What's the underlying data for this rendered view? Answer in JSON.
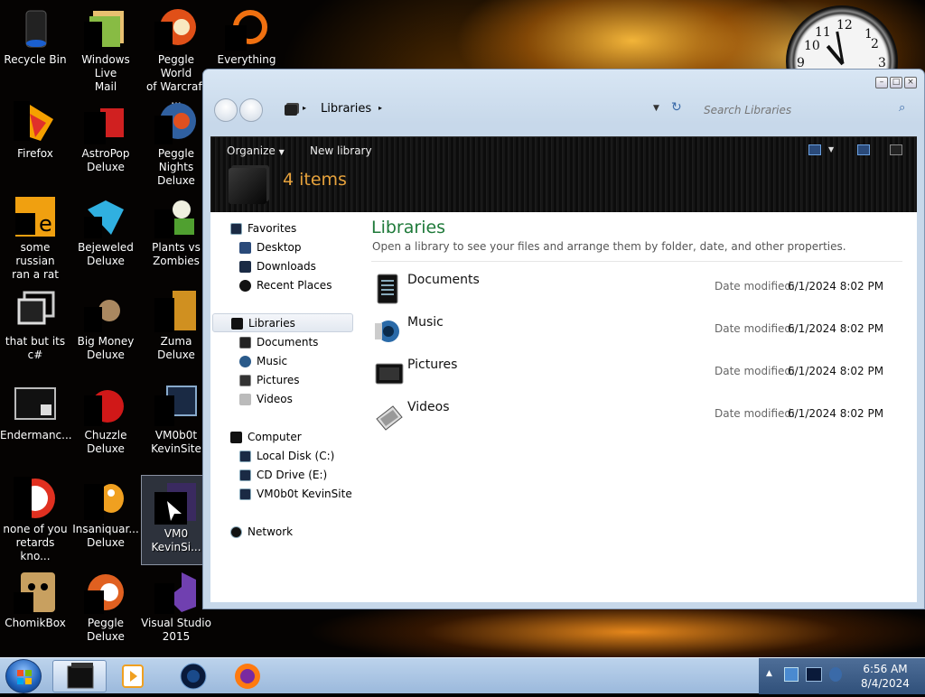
{
  "desktop": {
    "icons": [
      {
        "label": "Recycle Bin"
      },
      {
        "label": "Windows Live\nMail"
      },
      {
        "label": "Peggle World\nof Warcraft ..."
      },
      {
        "label": "Everything"
      },
      {
        "label": "Firefox"
      },
      {
        "label": "AstroPop\nDeluxe"
      },
      {
        "label": "Peggle Nights\nDeluxe"
      },
      {
        "label": "some russian\nran a rat"
      },
      {
        "label": "Bejeweled\nDeluxe"
      },
      {
        "label": "Plants vs\nZombies"
      },
      {
        "label": "that but its c#"
      },
      {
        "label": "Big Money\nDeluxe"
      },
      {
        "label": "Zuma Deluxe"
      },
      {
        "label": "Endermanc..."
      },
      {
        "label": "Chuzzle\nDeluxe"
      },
      {
        "label": "VM0b0t\nKevinSite"
      },
      {
        "label": "none of you\nretards kno..."
      },
      {
        "label": "Insaniquar...\nDeluxe"
      },
      {
        "label": "VM0\nKevinSi..."
      },
      {
        "label": "ChomikBox"
      },
      {
        "label": "Peggle Deluxe"
      },
      {
        "label": "Visual Studio\n2015"
      }
    ],
    "clock_numbers": [
      "12",
      "1",
      "2",
      "10",
      "11",
      "9",
      "3"
    ]
  },
  "window": {
    "breadcrumb": "Libraries",
    "search_placeholder": "Search Libraries",
    "toolbar": {
      "organize": "Organize",
      "new_library": "New library"
    },
    "item_count": "4 items",
    "nav": {
      "favorites": "Favorites",
      "desktop": "Desktop",
      "downloads": "Downloads",
      "recent": "Recent Places",
      "libraries": "Libraries",
      "documents": "Documents",
      "music": "Music",
      "pictures": "Pictures",
      "videos": "Videos",
      "computer": "Computer",
      "local_disk": "Local Disk (C:)",
      "cd_drive": "CD Drive (E:)",
      "vm_drive": "VM0b0t KevinSite",
      "network": "Network"
    },
    "main": {
      "title": "Libraries",
      "subtitle": "Open a library to see your files and arrange them by folder, date, and other properties.",
      "date_label": "Date modified:",
      "items": [
        {
          "name": "Documents",
          "date": "6/1/2024 8:02 PM"
        },
        {
          "name": "Music",
          "date": "6/1/2024 8:02 PM"
        },
        {
          "name": "Pictures",
          "date": "6/1/2024 8:02 PM"
        },
        {
          "name": "Videos",
          "date": "6/1/2024 8:02 PM"
        }
      ]
    }
  },
  "taskbar": {
    "time": "6:56 AM",
    "date": "8/4/2024"
  },
  "colors": {
    "accent_green": "#1f7a3a",
    "item_count": "#e6a23c"
  }
}
